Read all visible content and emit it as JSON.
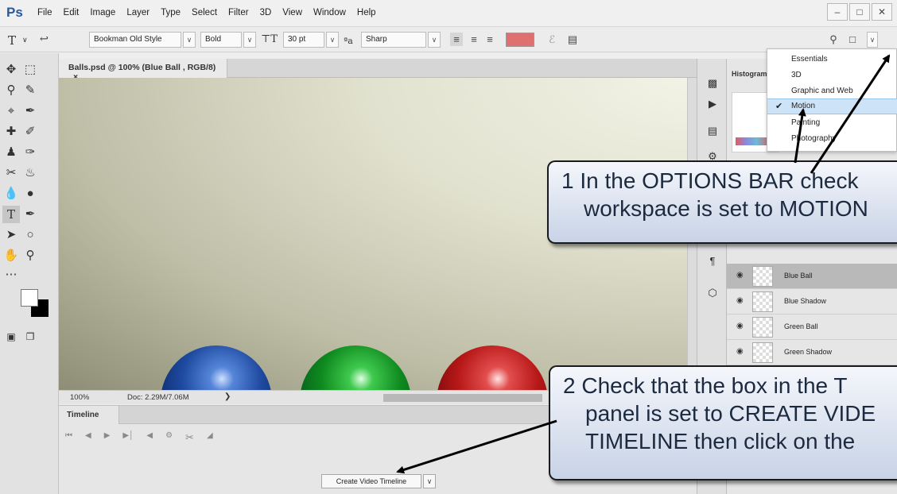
{
  "app": {
    "logo": "Ps",
    "menu": [
      "File",
      "Edit",
      "Image",
      "Layer",
      "Type",
      "Select",
      "Filter",
      "3D",
      "View",
      "Window",
      "Help"
    ],
    "window_controls": [
      "minimize-icon",
      "maximize-icon",
      "close-icon"
    ]
  },
  "options_bar": {
    "font_family": "Bookman Old Style",
    "font_style": "Bold",
    "font_size": "30 pt",
    "antialias_glyph": "ªa",
    "antialias": "Sharp",
    "text_color": "#e07070"
  },
  "document": {
    "tab_title": "Balls.psd @ 100% (Blue Ball , RGB/8)",
    "tab_close": "×",
    "zoom": "100%",
    "doc_size": "Doc: 2.29M/7.06M"
  },
  "timeline": {
    "tab_label": "Timeline",
    "create_button": "Create Video Timeline"
  },
  "histogram": {
    "tab_label": "Histogram"
  },
  "layers": [
    {
      "name": "Blue Ball",
      "selected": true
    },
    {
      "name": "Blue Shadow",
      "selected": false
    },
    {
      "name": "Green Ball",
      "selected": false
    },
    {
      "name": "Green Shadow",
      "selected": false
    }
  ],
  "workspace_menu": {
    "items": [
      "Essentials",
      "3D",
      "Graphic and Web",
      "Motion",
      "Painting",
      "Photography"
    ],
    "selected": "Motion"
  },
  "callouts": {
    "one": {
      "line1": "1  In the OPTIONS BAR check",
      "line2": "workspace is set to MOTION"
    },
    "two": {
      "line1": "2  Check that the box in the T",
      "line2": "panel is set to CREATE VIDE",
      "line3": "TIMELINE then click on the"
    }
  },
  "colors": {
    "accent": "#2a5a9e",
    "menu_selection": "#cde3f7",
    "blue_ball": "#1e4aa0",
    "green_ball": "#0f8a1f",
    "red_ball": "#b81818"
  }
}
